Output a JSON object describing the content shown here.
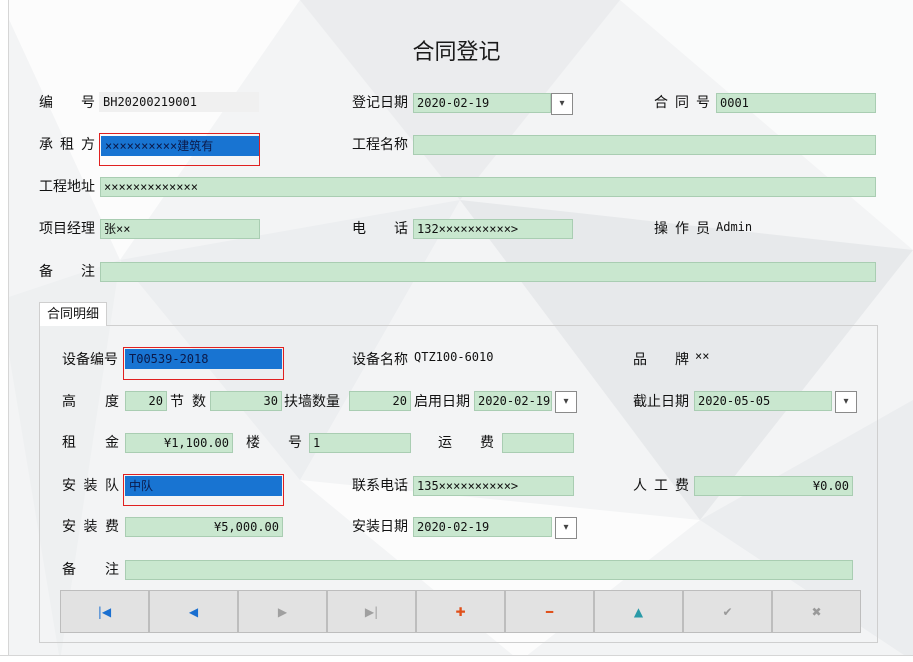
{
  "title": "合同登记",
  "header": {
    "bianhao": {
      "label": "编号",
      "value": "BH20200219001"
    },
    "dengji_date": {
      "label": "登记日期",
      "value": "2020-02-19"
    },
    "hetong_no": {
      "label": "合同号",
      "value": "0001"
    },
    "chengzufang": {
      "label": "承租方",
      "value": "××××××××××建筑有"
    },
    "gongcheng_name": {
      "label": "工程名称",
      "value": ""
    },
    "gongcheng_addr": {
      "label": "工程地址",
      "value": "×××××××××××××"
    },
    "xiangmu_jingli": {
      "label": "项目经理",
      "value": "张××"
    },
    "dianhua": {
      "label": "电话",
      "value": "132××××××××××>"
    },
    "caozuoyuan": {
      "label": "操作员",
      "value": "Admin"
    },
    "beizhu": {
      "label": "备注",
      "value": ""
    }
  },
  "detail_tab": "合同明细",
  "detail": {
    "shebei_no": {
      "label": "设备编号",
      "value": "T00539-2018"
    },
    "shebei_name": {
      "label": "设备名称",
      "value": "QTZ100-6010"
    },
    "pinpai": {
      "label": "品牌",
      "value": "××"
    },
    "gaodu": {
      "label": "高度",
      "value": "20"
    },
    "jieshu": {
      "label": "节数",
      "value": "30"
    },
    "fuqiang": {
      "label": "扶墙数量",
      "value": "20"
    },
    "qiyong_date": {
      "label": "启用日期",
      "value": "2020-02-19"
    },
    "jiezhi_date": {
      "label": "截止日期",
      "value": "2020-05-05"
    },
    "zujin": {
      "label": "租金",
      "value": "¥1,100.00"
    },
    "louhao": {
      "label": "楼号",
      "value": "1"
    },
    "yunfei": {
      "label": "运费",
      "value": ""
    },
    "anzhuang_dui": {
      "label": "安装队",
      "value": "中队"
    },
    "lianxi_dianhua": {
      "label": "联系电话",
      "value": "135××××××××××>"
    },
    "rengongfei": {
      "label": "人工费",
      "value": "¥0.00"
    },
    "anzhuangfei": {
      "label": "安装费",
      "value": "¥5,000.00"
    },
    "anzhuang_date": {
      "label": "安装日期",
      "value": "2020-02-19"
    },
    "beizhu": {
      "label": "备注",
      "value": ""
    }
  },
  "dropdown_glyph": "▾",
  "nav_buttons": [
    {
      "icon": "first-record-icon",
      "glyph": "|◀",
      "color": "#1a6fd0"
    },
    {
      "icon": "prev-record-icon",
      "glyph": "◀",
      "color": "#1a6fd0"
    },
    {
      "icon": "next-record-icon",
      "glyph": "▶",
      "color": "#a0a0a0"
    },
    {
      "icon": "last-record-icon",
      "glyph": "▶|",
      "color": "#a0a0a0"
    },
    {
      "icon": "add-icon",
      "glyph": "✚",
      "color": "#e0501a"
    },
    {
      "icon": "delete-icon",
      "glyph": "━",
      "color": "#e0501a"
    },
    {
      "icon": "edit-up-icon",
      "glyph": "▲",
      "color": "#2a9aa8"
    },
    {
      "icon": "confirm-icon",
      "glyph": "✔",
      "color": "#9a9a9a"
    },
    {
      "icon": "cancel-icon",
      "glyph": "✖",
      "color": "#9a9a9a"
    }
  ]
}
